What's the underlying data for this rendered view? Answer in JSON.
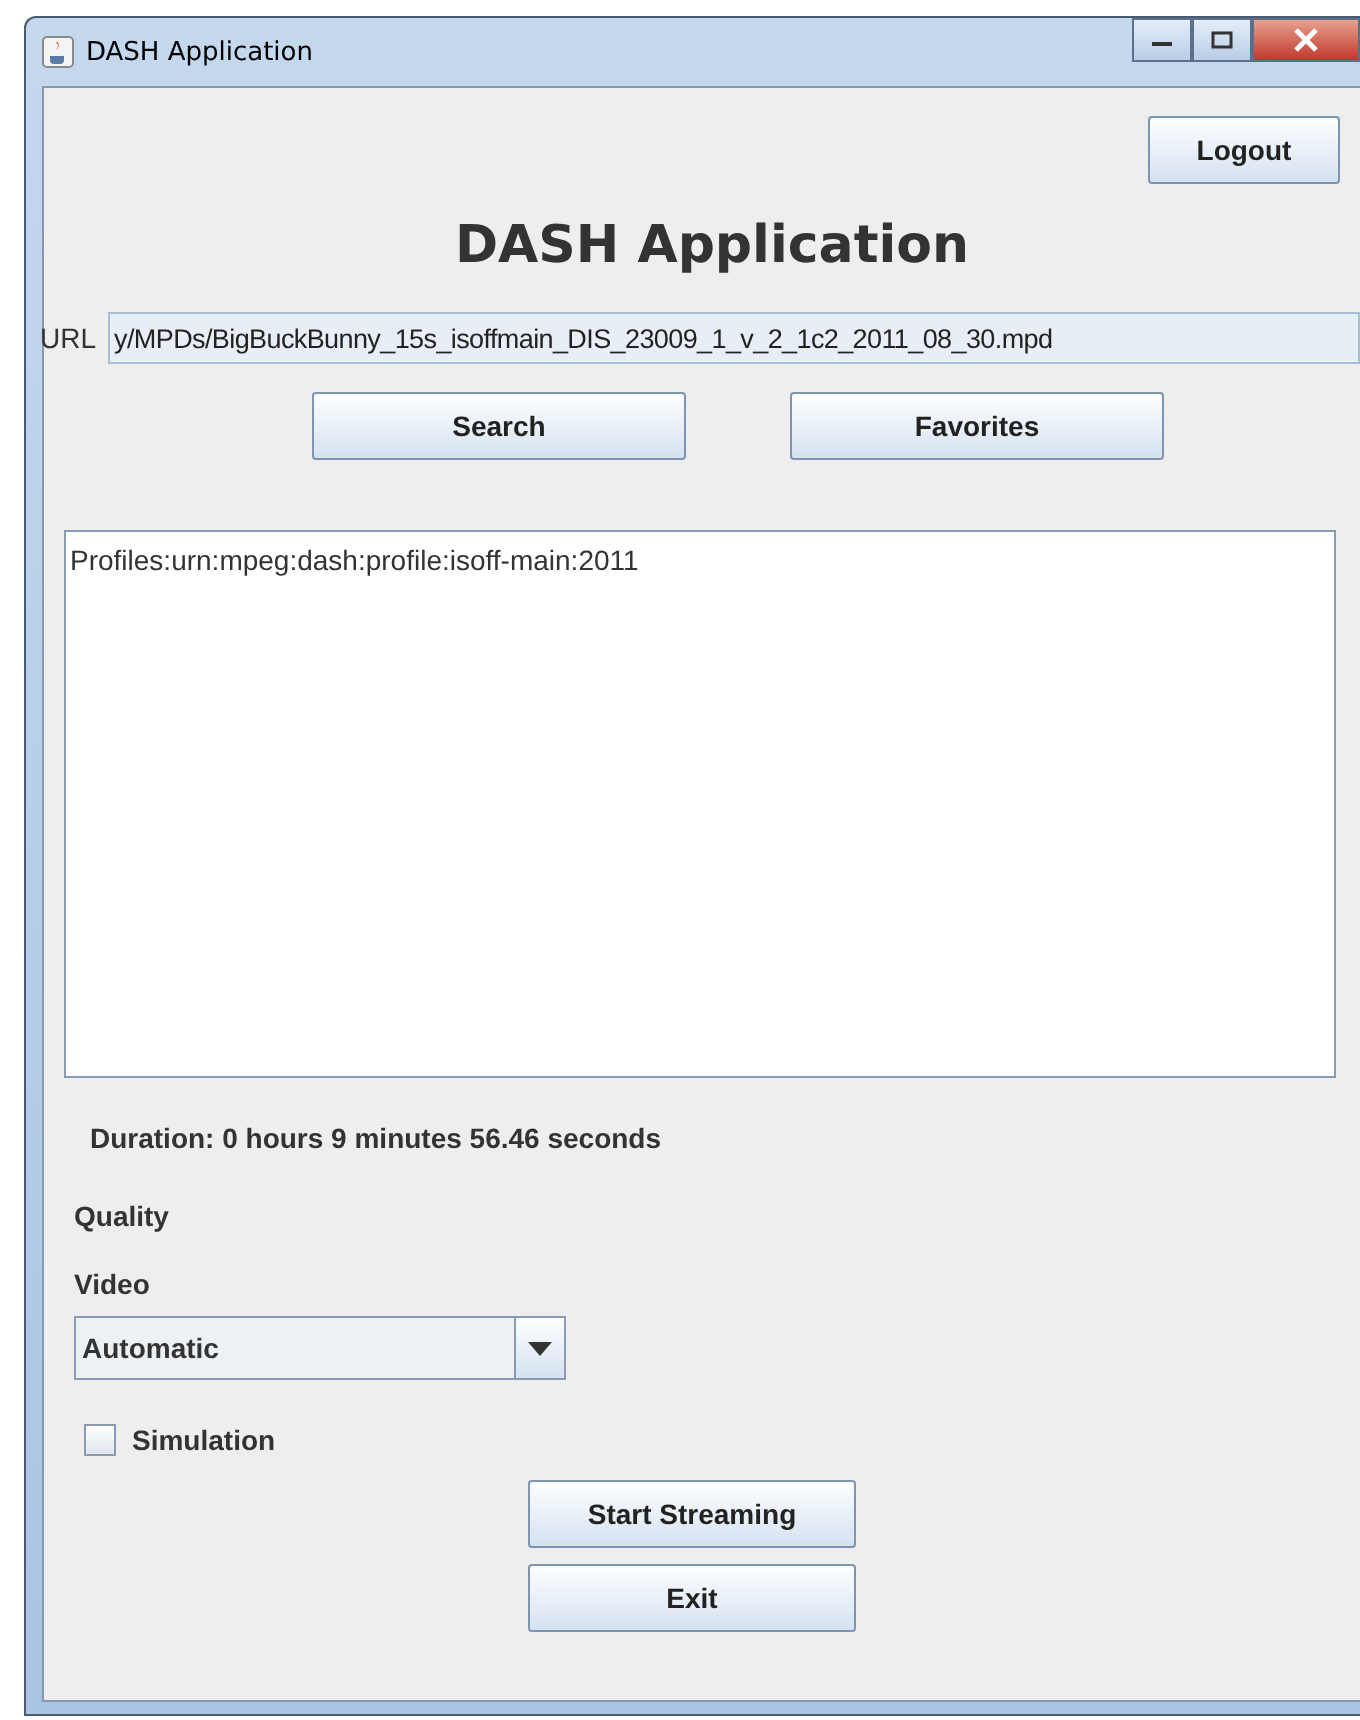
{
  "window": {
    "title": "DASH Application"
  },
  "logout_button": "Logout",
  "heading": "DASH Application",
  "url": {
    "label": "URL",
    "value": "y/MPDs/BigBuckBunny_15s_isoffmain_DIS_23009_1_v_2_1c2_2011_08_30.mpd"
  },
  "buttons": [
    "Search",
    "Favorites"
  ],
  "output_text": "Profiles:urn:mpeg:dash:profile:isoff-main:2011",
  "duration": "Duration: 0 hours 9 minutes 56.46 seconds",
  "quality_label": "Quality",
  "video_label": "Video",
  "video_select": {
    "value": "Automatic"
  },
  "simulation": {
    "label": "Simulation",
    "checked": false
  },
  "actions": [
    "Start Streaming",
    "Exit"
  ]
}
